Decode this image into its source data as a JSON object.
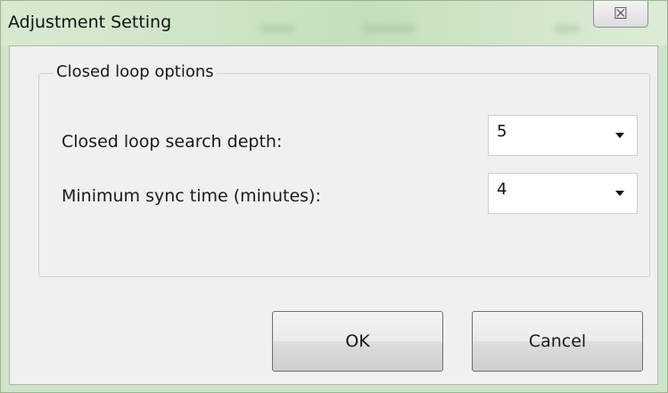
{
  "window": {
    "title": "Adjustment Setting",
    "close_glyph": "☒"
  },
  "group": {
    "title": "Closed loop options",
    "fields": [
      {
        "label": "Closed loop search depth:",
        "value": "5"
      },
      {
        "label": "Minimum sync time (minutes):",
        "value": "4"
      }
    ]
  },
  "buttons": {
    "ok": "OK",
    "cancel": "Cancel"
  },
  "icons": {
    "close": "close-icon",
    "dropdown": "chevron-down-icon"
  },
  "colors": {
    "titlebar": "#cfe3c6",
    "client": "#f0f0f0",
    "button_border": "#707070"
  }
}
